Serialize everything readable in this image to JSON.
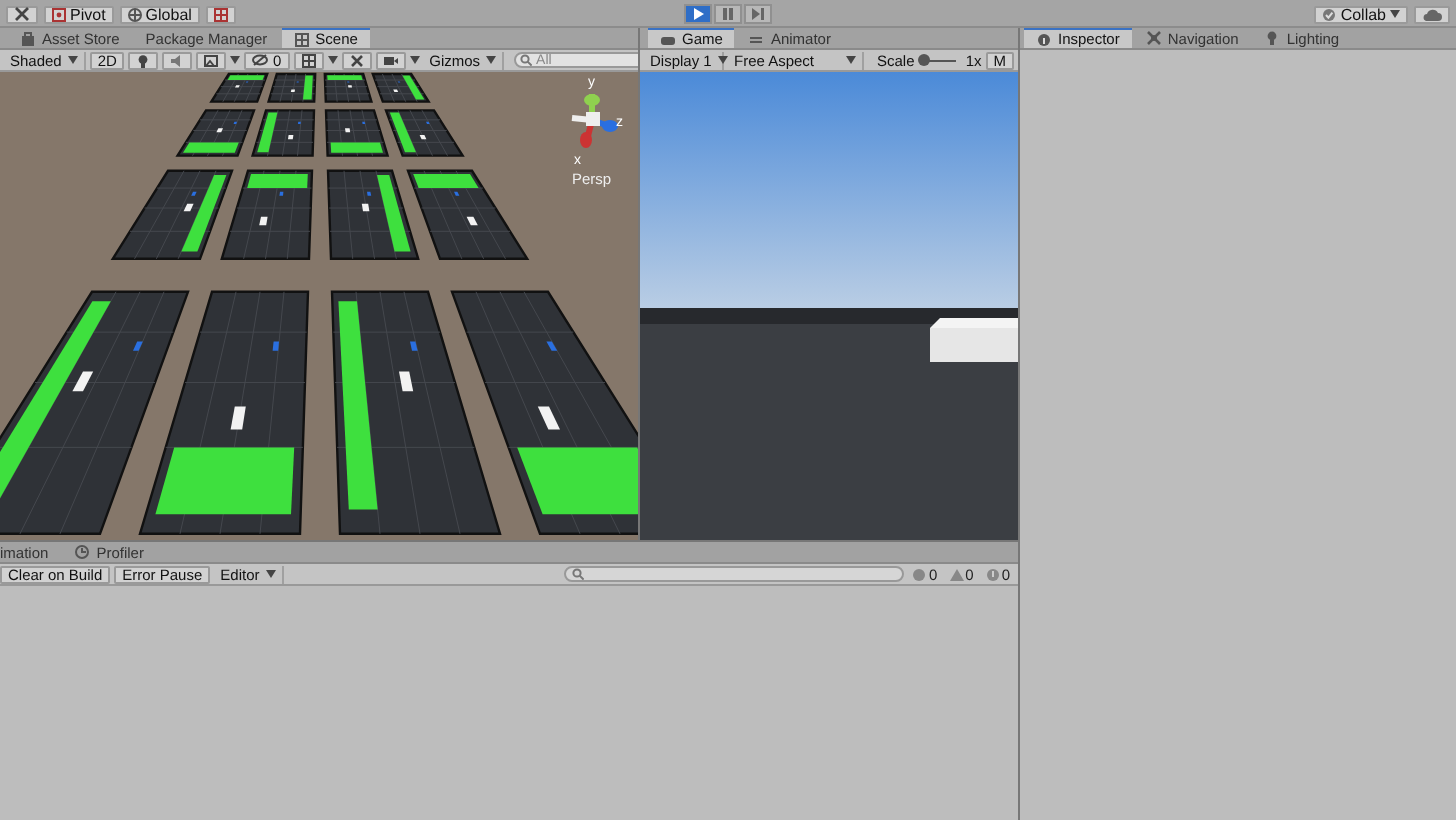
{
  "toolbar": {
    "pivot": "Pivot",
    "global": "Global",
    "collab": "Collab",
    "play_controls": [
      {
        "kind": "play",
        "selected": true
      },
      {
        "kind": "pause",
        "selected": false
      },
      {
        "kind": "step",
        "selected": false
      }
    ]
  },
  "scene_dock": {
    "tabs": [
      {
        "label": "Asset Store",
        "kind": "store",
        "selected": false
      },
      {
        "label": "Package Manager",
        "kind": "package",
        "selected": false
      },
      {
        "label": "Scene",
        "kind": "scene",
        "selected": true
      }
    ],
    "shading": "Shaded",
    "mode_2d": "2D",
    "hidden_count": "0",
    "gizmos": "Gizmos",
    "search_placeholder": "All",
    "camera_mode": "Persp",
    "axes": [
      "y",
      "z",
      "x"
    ]
  },
  "game_dock": {
    "tabs": [
      {
        "label": "Game",
        "kind": "game",
        "selected": true
      },
      {
        "label": "Animator",
        "kind": "animator",
        "selected": false
      }
    ],
    "display": "Display 1",
    "aspect": "Free Aspect",
    "scale": {
      "label": "Scale",
      "level": 0,
      "reading": "1x"
    },
    "maximize": "M"
  },
  "inspector_dock": {
    "tabs": [
      {
        "label": "Inspector",
        "kind": "inspector",
        "selected": true
      },
      {
        "label": "Navigation",
        "kind": "navigation",
        "selected": false
      },
      {
        "label": "Lighting",
        "kind": "lighting",
        "selected": false
      }
    ]
  },
  "console_dock": {
    "tabs": [
      {
        "label": "imation",
        "kind": "animation",
        "selected": false
      },
      {
        "label": "Profiler",
        "kind": "profiler",
        "selected": false
      }
    ],
    "buttons": [
      "Clear on Build",
      "Error Pause"
    ],
    "filter": "Editor",
    "counts": [
      {
        "kind": "info",
        "value": "0"
      },
      {
        "kind": "warning",
        "value": "0"
      },
      {
        "kind": "error",
        "value": "0"
      }
    ]
  }
}
